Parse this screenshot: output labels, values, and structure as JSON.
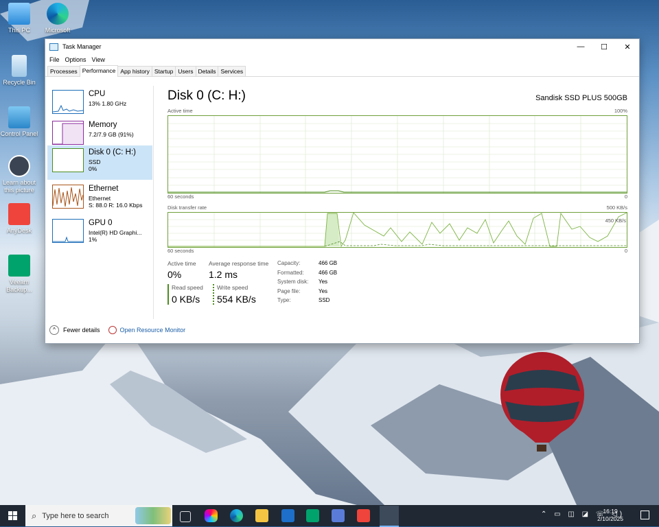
{
  "desktop": {
    "icons": [
      {
        "label": "This PC"
      },
      {
        "label": "Microsoft"
      },
      {
        "label": "Recycle Bin"
      },
      {
        "label": "Control Panel"
      },
      {
        "label": "Learn about this picture"
      },
      {
        "label": "AnyDesk"
      },
      {
        "label": "Veeam Backup..."
      }
    ]
  },
  "window": {
    "title": "Task Manager",
    "controls": {
      "minimize": "—",
      "maximize": "☐",
      "close": "✕"
    },
    "menu": [
      "File",
      "Options",
      "View"
    ],
    "tabs": [
      "Processes",
      "Performance",
      "App history",
      "Startup",
      "Users",
      "Details",
      "Services"
    ],
    "active_tab": "Performance"
  },
  "sidebar": {
    "items": [
      {
        "name": "CPU",
        "line1": "13% 1.80 GHz",
        "line2": "",
        "color": "#1c6db8"
      },
      {
        "name": "Memory",
        "line1": "7.2/7.9 GB (91%)",
        "line2": "",
        "color": "#8b2b9e"
      },
      {
        "name": "Disk 0 (C: H:)",
        "line1": "SSD",
        "line2": "0%",
        "color": "#4c8c1e"
      },
      {
        "name": "Ethernet",
        "line1": "Ethernet",
        "line2": "S: 88.0 R: 16.0 Kbps",
        "color": "#a8551a"
      },
      {
        "name": "GPU 0",
        "line1": "Intel(R) HD Graphi...",
        "line2": "1%",
        "color": "#1c6db8"
      }
    ]
  },
  "disk": {
    "title": "Disk 0 (C: H:)",
    "model": "Sandisk SSD PLUS 500GB",
    "graph1": {
      "label": "Active time",
      "max_label": "100%",
      "xlabel": "60 seconds",
      "min_label": "0"
    },
    "graph2": {
      "label": "Disk transfer rate",
      "max_label": "500 KB/s",
      "inner_label": "450 KB/s",
      "xlabel": "60 seconds",
      "min_label": "0"
    },
    "stats": {
      "active_time_label": "Active time",
      "active_time_value": "0%",
      "avg_response_label": "Average response time",
      "avg_response_value": "1.2 ms",
      "read_label": "Read speed",
      "read_value": "0 KB/s",
      "write_label": "Write speed",
      "write_value": "554 KB/s"
    },
    "properties": [
      {
        "k": "Capacity:",
        "v": "466 GB"
      },
      {
        "k": "Formatted:",
        "v": "466 GB"
      },
      {
        "k": "System disk:",
        "v": "Yes"
      },
      {
        "k": "Page file:",
        "v": "Yes"
      },
      {
        "k": "Type:",
        "v": "SSD"
      }
    ]
  },
  "footer": {
    "fewer_details": "Fewer details",
    "resource_monitor": "Open Resource Monitor"
  },
  "taskbar": {
    "search_placeholder": "Type here to search",
    "time": "16:19",
    "date": "2/10/2025"
  }
}
